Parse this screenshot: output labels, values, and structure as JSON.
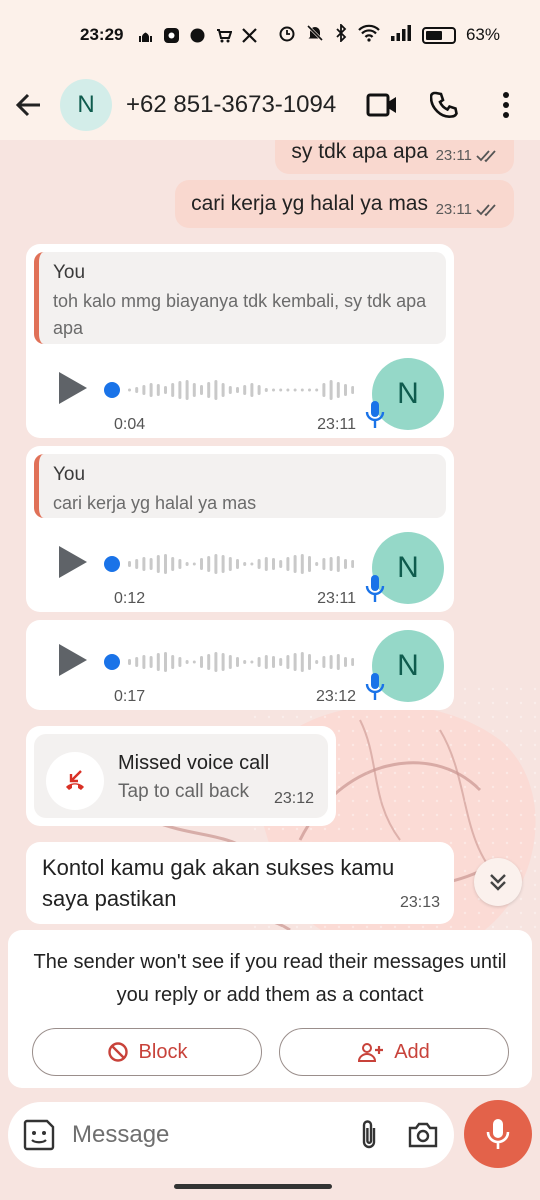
{
  "status": {
    "time": "23:29",
    "battery": "63%",
    "battery_level": 0.63,
    "notification_icons": [
      "mosque-icon",
      "toko-app-icon",
      "messenger-icon",
      "shop-icon",
      "x-icon"
    ],
    "system_icons": [
      "alarm-icon",
      "mute-icon",
      "bluetooth-icon",
      "wifi-icon",
      "signal-icon"
    ]
  },
  "header": {
    "avatar_letter": "N",
    "contact": "+62 851-3673-1094"
  },
  "messages": {
    "out1": {
      "text": "sy tdk apa apa",
      "time": "23:11"
    },
    "out2": {
      "text": "cari kerja yg halal ya mas",
      "time": "23:11"
    },
    "voice1": {
      "quote_author": "You",
      "quote_text": "toh kalo mmg biayanya tdk kembali, sy tdk apa apa",
      "duration": "0:04",
      "time": "23:11",
      "avatar": "N"
    },
    "voice2": {
      "quote_author": "You",
      "quote_text": "cari kerja yg halal ya mas",
      "duration": "0:12",
      "time": "23:11",
      "avatar": "N"
    },
    "voice3": {
      "duration": "0:17",
      "time": "23:12",
      "avatar": "N"
    },
    "missed_call": {
      "title": "Missed voice call",
      "subtitle": "Tap to call back",
      "time": "23:12"
    },
    "text1": {
      "text": "Kontol kamu gak akan sukses kamu saya pastikan",
      "time": "23:13"
    }
  },
  "notice": {
    "message": "The sender won't see if you read their messages until you reply or add them as a contact",
    "block_label": "Block",
    "add_label": "Add"
  },
  "composer": {
    "placeholder": "Message"
  },
  "colors": {
    "accent": "#e3624a",
    "outgoing_bubble": "#f9d8cf",
    "incoming_bubble": "#ffffff",
    "avatar_bg": "#95d8c8",
    "block_red": "#c8423a",
    "read_tick": "#555555",
    "wave_progress": "#1a73e8"
  }
}
